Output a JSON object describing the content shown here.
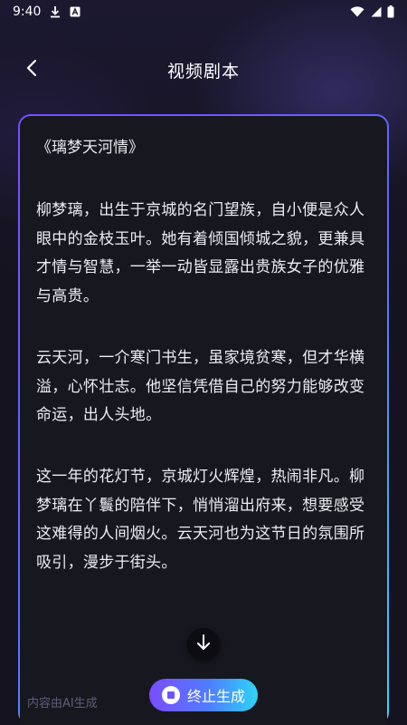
{
  "status_bar": {
    "time": "9:40",
    "left_icons": [
      "download-icon",
      "a-box-icon"
    ],
    "right_icons": [
      "wifi-icon",
      "signal-icon",
      "battery-icon"
    ]
  },
  "header": {
    "title": "视频剧本",
    "back_icon": "chevron-left-icon"
  },
  "script": {
    "title": "《璃梦天河情》",
    "paragraphs": [
      "柳梦璃，出生于京城的名门望族，自小便是众人眼中的金枝玉叶。她有着倾国倾城之貌，更兼具才情与智慧，一举一动皆显露出贵族女子的优雅与高贵。",
      "云天河，一介寒门书生，虽家境贫寒，但才华横溢，心怀壮志。他坚信凭借自己的努力能够改变命运，出人头地。",
      "这一年的花灯节，京城灯火辉煌，热闹非凡。柳梦璃在丫鬟的陪伴下，悄悄溜出府来，想要感受这难得的人间烟火。云天河也为这节日的氛围所吸引，漫步于街头。"
    ]
  },
  "footer": {
    "ai_note": "内容由AI生成",
    "scroll_down_icon": "arrow-down-icon",
    "stop_button_label": "终止生成",
    "stop_icon": "stop-icon"
  },
  "colors": {
    "background": "#14121f",
    "card_background": "#17181f",
    "accent_start": "#7a4dff",
    "accent_end": "#2fd4f6",
    "muted_text": "#5e5b7a"
  }
}
